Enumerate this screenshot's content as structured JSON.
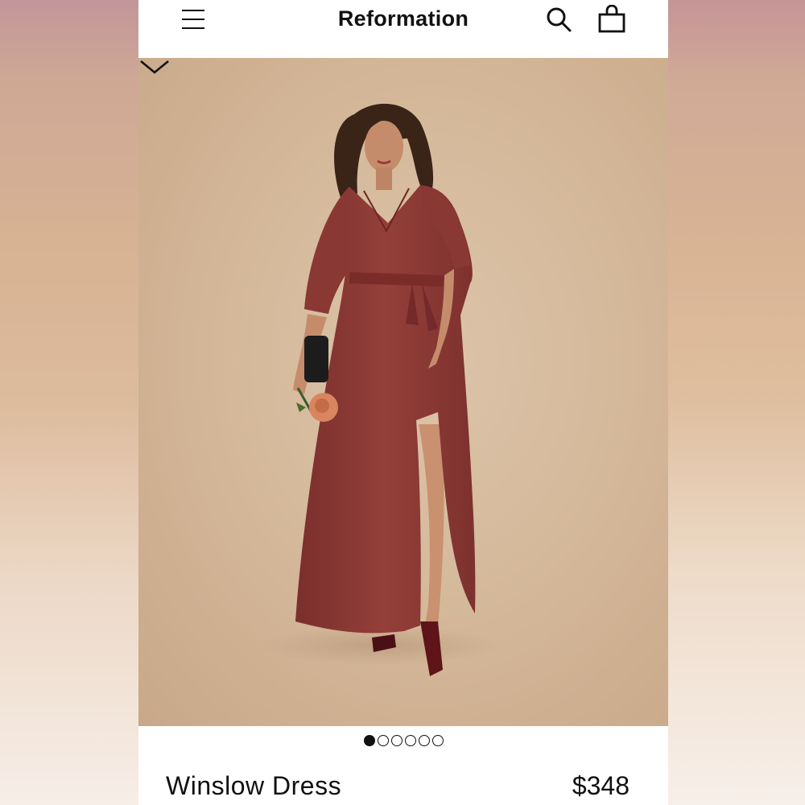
{
  "header": {
    "brand": "Reformation",
    "menu_icon": "hamburger-menu-icon",
    "search_icon": "search-icon",
    "bag_icon": "shopping-bag-icon"
  },
  "gallery": {
    "image_count": 6,
    "active_index": 0,
    "collapse_icon": "chevron-down-icon"
  },
  "product": {
    "name": "Winslow Dress",
    "price": "$348"
  },
  "colors": {
    "dress": "#8b3a36",
    "backdrop": "#d5b99b",
    "text": "#111111"
  }
}
